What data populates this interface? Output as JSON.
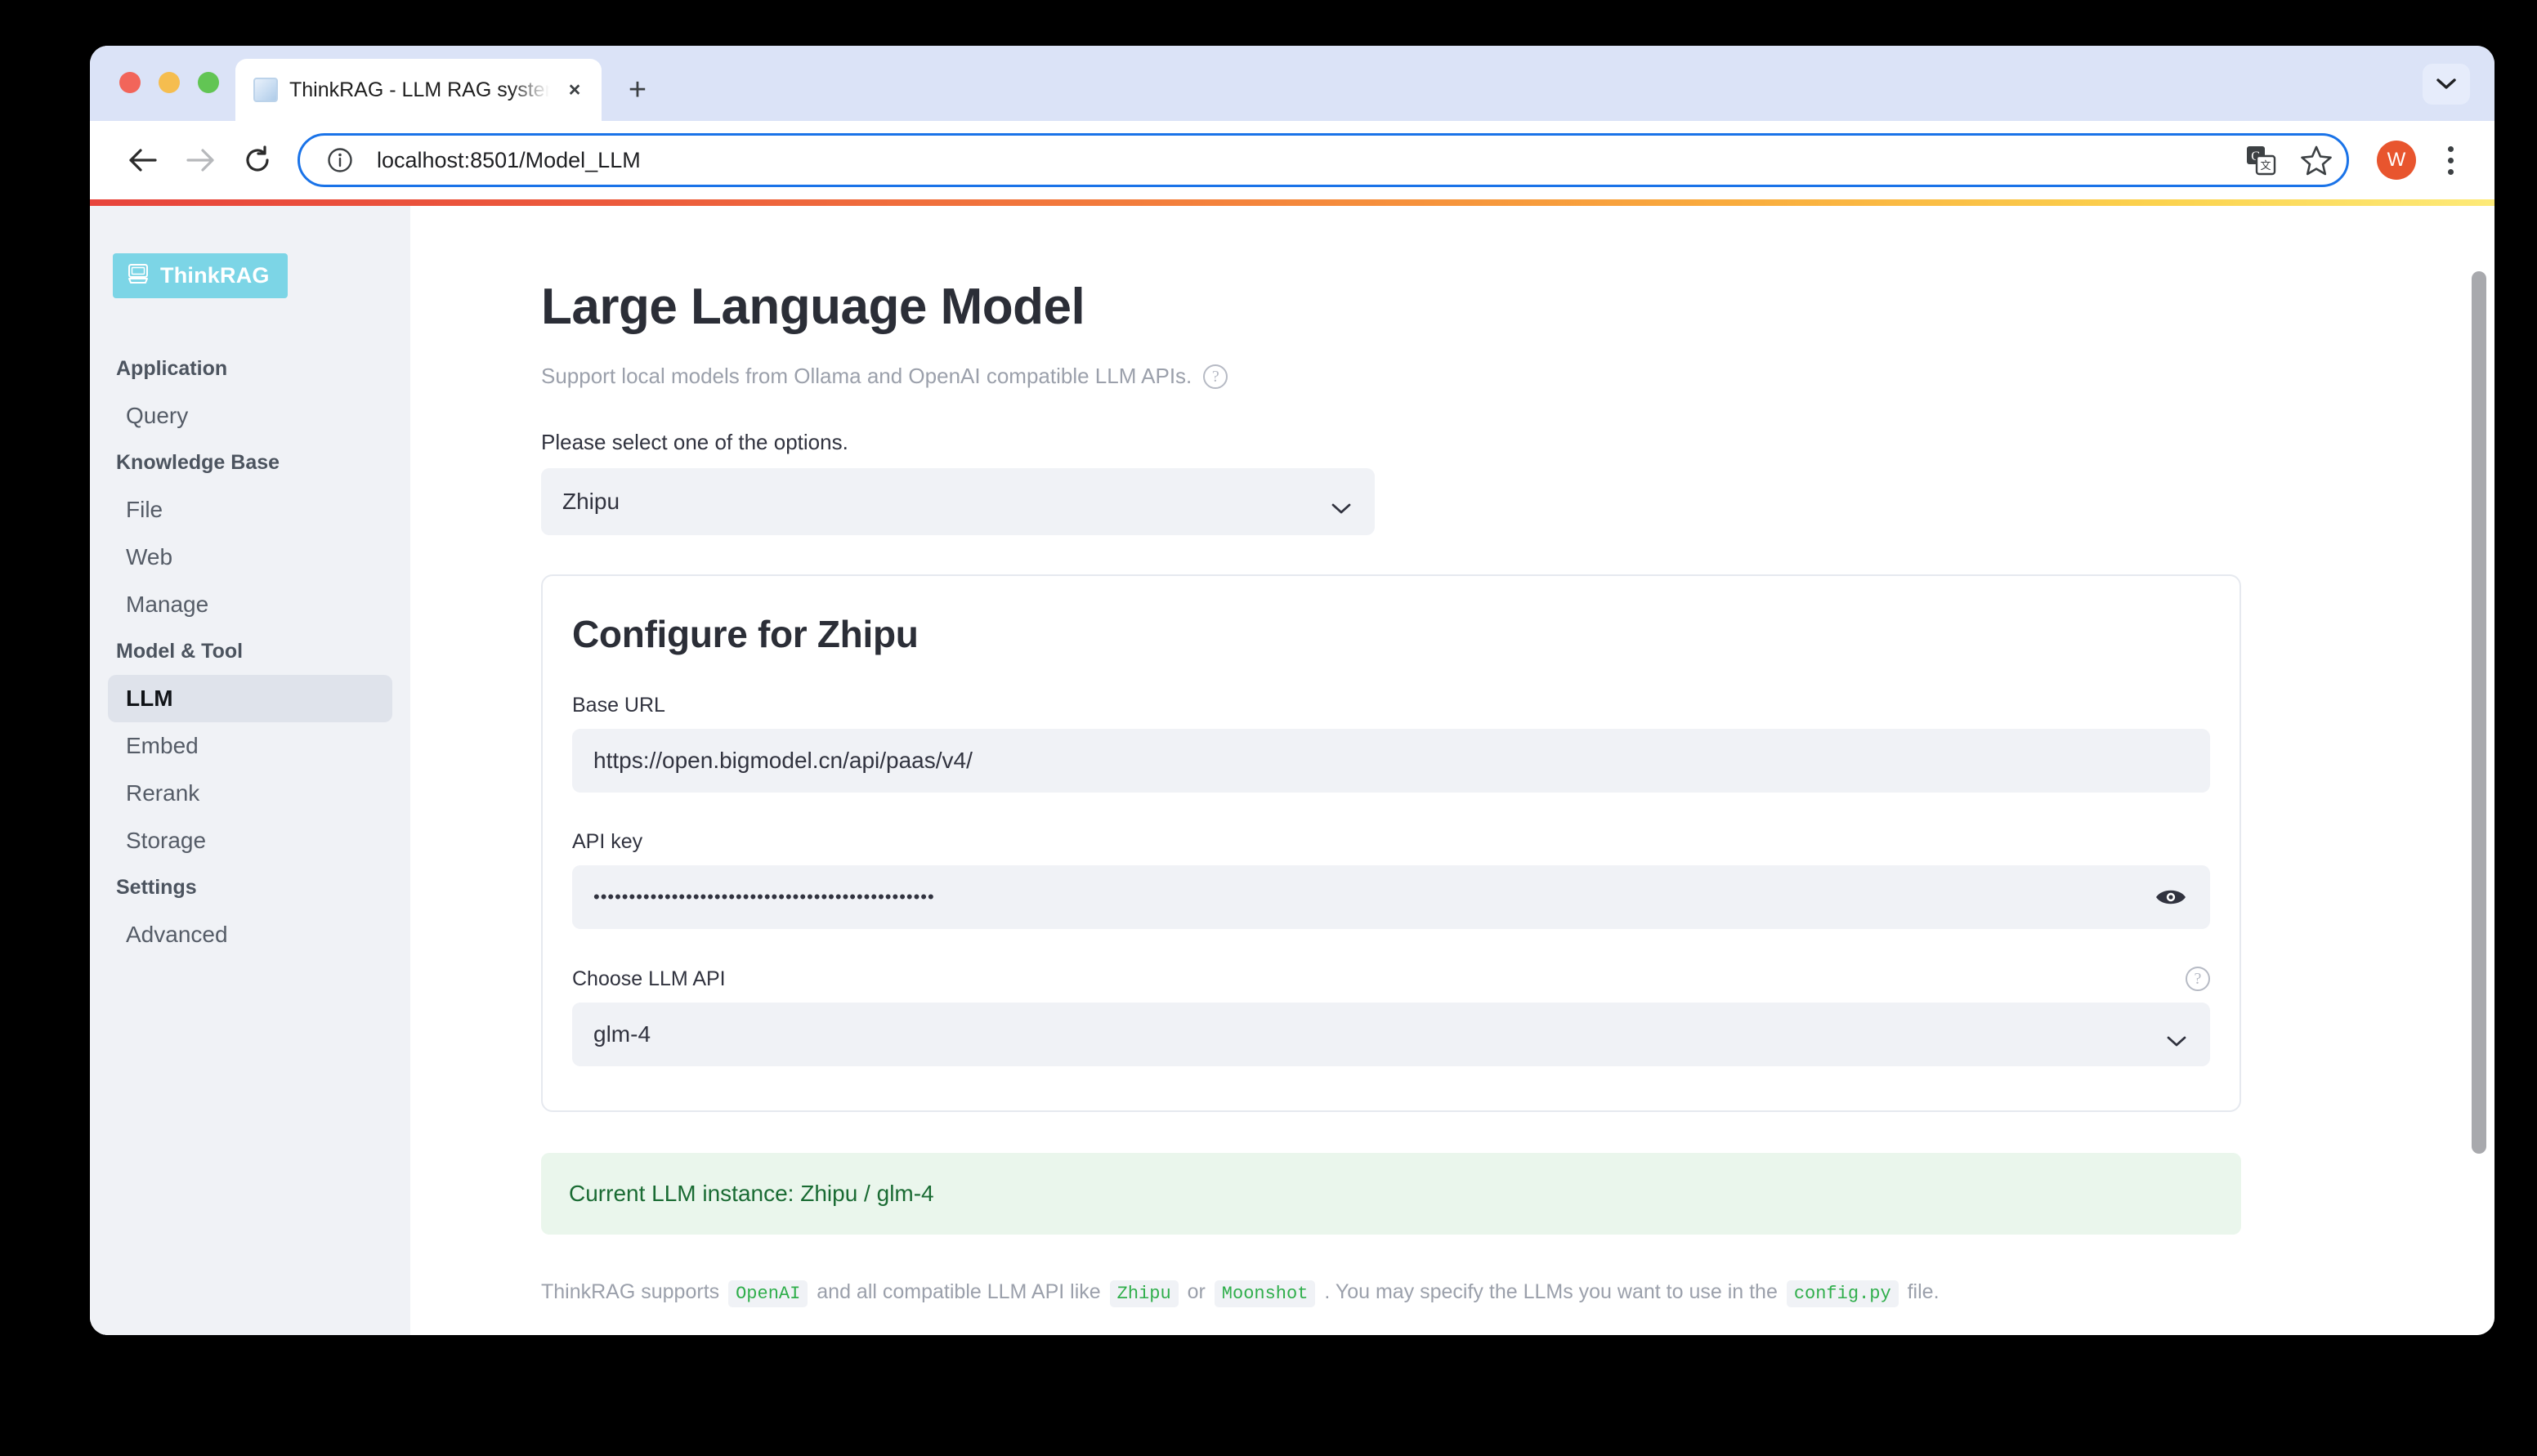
{
  "browser": {
    "tab": {
      "title": "ThinkRAG - LLM RAG system",
      "favicon": "cube-icon",
      "close": "×"
    },
    "new_tab": "+",
    "tabstrip_chevron": "chevron-down-icon",
    "toolbar": {
      "back": "←",
      "forward": "→",
      "reload": "↻",
      "url": "localhost:8501/Model_LLM",
      "site_info_icon": "info-circle-icon",
      "translate_icon": "translate-icon",
      "bookmark_icon": "star-icon",
      "avatar_letter": "W",
      "menu_icon": "kebab-menu-icon"
    }
  },
  "sidebar": {
    "logo_text": "ThinkRAG",
    "logo_color": "#7cd5e6",
    "nav": [
      {
        "type": "group",
        "label": "Application"
      },
      {
        "type": "item",
        "label": "Query",
        "active": false
      },
      {
        "type": "group",
        "label": "Knowledge Base"
      },
      {
        "type": "item",
        "label": "File",
        "active": false
      },
      {
        "type": "item",
        "label": "Web",
        "active": false
      },
      {
        "type": "item",
        "label": "Manage",
        "active": false
      },
      {
        "type": "group",
        "label": "Model & Tool"
      },
      {
        "type": "item",
        "label": "LLM",
        "active": true
      },
      {
        "type": "item",
        "label": "Embed",
        "active": false
      },
      {
        "type": "item",
        "label": "Rerank",
        "active": false
      },
      {
        "type": "item",
        "label": "Storage",
        "active": false
      },
      {
        "type": "group",
        "label": "Settings"
      },
      {
        "type": "item",
        "label": "Advanced",
        "active": false
      }
    ]
  },
  "main": {
    "title": "Large Language Model",
    "subtitle": "Support local models from Ollama and OpenAI compatible LLM APIs.",
    "subtitle_help_icon": "help-circle-icon",
    "select_label": "Please select one of the options.",
    "provider_value": "Zhipu",
    "provider_chevron": "chevron-down-icon",
    "card": {
      "title": "Configure for Zhipu",
      "base_url_label": "Base URL",
      "base_url_value": "https://open.bigmodel.cn/api/paas/v4/",
      "api_key_label": "API key",
      "api_key_value": "••••••••••••••••••••••••••••••••••••••••••••••••",
      "api_key_reveal_icon": "eye-icon",
      "llm_api_label": "Choose LLM API",
      "llm_api_help_icon": "help-circle-icon",
      "llm_api_value": "glm-4",
      "llm_api_chevron": "chevron-down-icon"
    },
    "alert_text": "Current LLM instance: Zhipu / glm-4",
    "alert_color": "#1a6b33",
    "footnote": {
      "part1": "ThinkRAG supports",
      "code1": "OpenAI",
      "part2": "and all compatible LLM API like",
      "code2": "Zhipu",
      "part3": "or",
      "code3": "Moonshot",
      "part4": ". You may specify the LLMs you want to use in the",
      "code4": "config.py",
      "part5": "file."
    }
  }
}
